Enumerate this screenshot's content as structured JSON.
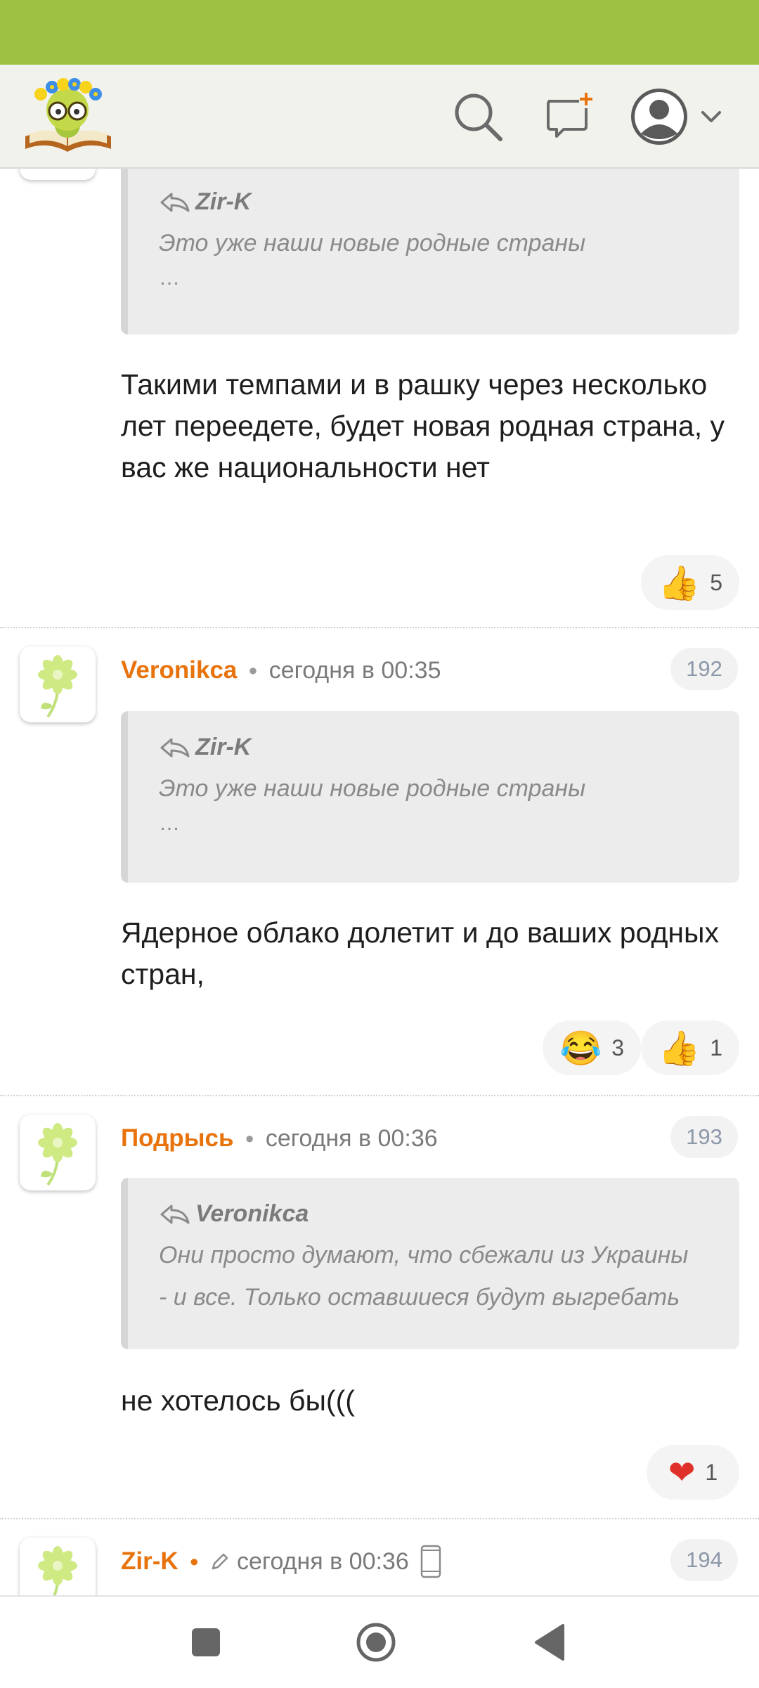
{
  "app": {
    "brand_colors": {
      "statusbar": "#9dc243",
      "accent": "#e8730c",
      "nav_icons": "#666666"
    },
    "header_icons": [
      "logo-icon",
      "search-icon",
      "new-message-icon",
      "account-icon",
      "chevron-down-icon"
    ]
  },
  "posts": [
    {
      "quote": {
        "author": "Zir-K",
        "text": "Это уже наши новые родные страны",
        "more": "…"
      },
      "body": "Такими темпами и в рашку через несколько лет переедете, будет новая родная страна, у вас же национальности нет",
      "reactions": [
        {
          "icon": "thumbs-up-icon",
          "count": "5"
        }
      ]
    },
    {
      "author": "Veronikca",
      "time": "сегодня в 00:35",
      "number": "192",
      "quote": {
        "author": "Zir-K",
        "text": "Это уже наши новые родные страны",
        "more": "…"
      },
      "body": "Ядерное облако долетит и до ваших родных стран,",
      "reactions": [
        {
          "icon": "laughing-face-icon",
          "count": "3"
        },
        {
          "icon": "thumbs-up-icon",
          "count": "1"
        }
      ]
    },
    {
      "author": "Подрысь",
      "time": "сегодня в 00:36",
      "number": "193",
      "quote": {
        "author": "Veronikca",
        "text": "Они просто думают, что сбежали из Украины - и все. Только оставшиеся будут выгребать"
      },
      "body": "не хотелось бы(((",
      "reactions": [
        {
          "icon": "heart-icon",
          "count": "1"
        }
      ]
    },
    {
      "author": "Zir-K",
      "time": "сегодня в 00:36",
      "number": "194"
    }
  ]
}
